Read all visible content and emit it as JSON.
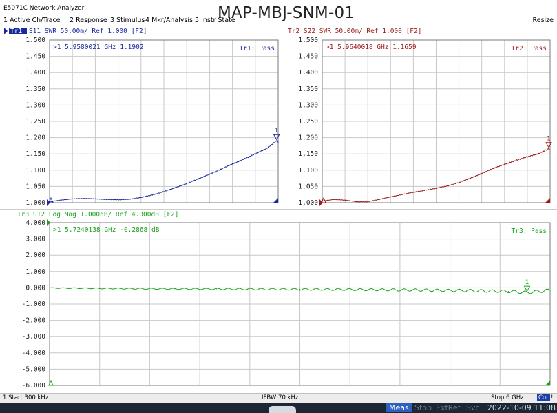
{
  "app_title": "E5071C Network Analyzer",
  "overlay_title": "MAP-MBJ-SNM-01",
  "menu": [
    "1 Active Ch/Trace",
    "2 Response",
    "3 Stimulus",
    "4 Mkr/Analysis",
    "5 Instr State"
  ],
  "resize_label": "Resize",
  "colors": {
    "tr1": "#1a2a9c",
    "tr2": "#9c1a1a",
    "tr3": "#1aa31a",
    "grid": "#c8c8c8",
    "frame": "#7a7a7a"
  },
  "chart_data": [
    {
      "type": "line",
      "trace_tag": "Tr1",
      "header": "Tr1 S11 SWR 50.00m/ Ref 1.000 [F2]",
      "pass_label": "Tr1: Pass",
      "marker_readout": ">1  5.9580021 GHz  1.1902",
      "y_ticks": [
        "1.500",
        "1.450",
        "1.400",
        "1.350",
        "1.300",
        "1.250",
        "1.200",
        "1.150",
        "1.100",
        "1.050",
        "1.000"
      ],
      "ylim": [
        1.0,
        1.5
      ],
      "xlim_ghz": [
        0.0003,
        6.0
      ],
      "marker_flag": "1",
      "x_ghz": [
        0.0003,
        0.3,
        0.6,
        0.9,
        1.2,
        1.5,
        1.8,
        2.1,
        2.4,
        2.7,
        3.0,
        3.3,
        3.6,
        3.9,
        4.2,
        4.5,
        4.8,
        5.1,
        5.4,
        5.7,
        5.958,
        6.0
      ],
      "values": [
        1.003,
        1.008,
        1.012,
        1.013,
        1.012,
        1.01,
        1.009,
        1.011,
        1.016,
        1.024,
        1.034,
        1.046,
        1.059,
        1.073,
        1.088,
        1.103,
        1.119,
        1.134,
        1.15,
        1.167,
        1.1902,
        1.186
      ]
    },
    {
      "type": "line",
      "trace_tag": "Tr2",
      "header": "Tr2 S22 SWR 50.00m/ Ref 1.000 [F2]",
      "pass_label": "Tr2: Pass",
      "marker_readout": ">1  5.9640018 GHz  1.1659",
      "y_ticks": [
        "1.500",
        "1.450",
        "1.400",
        "1.350",
        "1.300",
        "1.250",
        "1.200",
        "1.150",
        "1.100",
        "1.050",
        "1.000"
      ],
      "ylim": [
        1.0,
        1.5
      ],
      "xlim_ghz": [
        0.0003,
        6.0
      ],
      "marker_flag": "1",
      "x_ghz": [
        0.0003,
        0.3,
        0.6,
        0.9,
        1.2,
        1.5,
        1.8,
        2.1,
        2.4,
        2.7,
        3.0,
        3.3,
        3.6,
        3.9,
        4.2,
        4.5,
        4.8,
        5.1,
        5.4,
        5.7,
        5.964,
        6.0
      ],
      "values": [
        1.005,
        1.01,
        1.008,
        1.003,
        1.003,
        1.01,
        1.018,
        1.025,
        1.032,
        1.038,
        1.044,
        1.052,
        1.062,
        1.075,
        1.09,
        1.105,
        1.118,
        1.13,
        1.141,
        1.151,
        1.1659,
        1.162
      ]
    },
    {
      "type": "line",
      "trace_tag": "Tr3",
      "header": "Tr3 S12 Log Mag 1.000dB/ Ref 4.000dB [F2]",
      "pass_label": "Tr3: Pass",
      "marker_readout": ">1  5.7240138 GHz -0.2868 dB",
      "y_ticks": [
        "4.000",
        "3.000",
        "2.000",
        "1.000",
        "0.000",
        "-1.000",
        "-2.000",
        "-3.000",
        "-4.000",
        "-5.000",
        "-6.000"
      ],
      "ylim": [
        -6.0,
        4.0
      ],
      "xlim_ghz": [
        0.0003,
        6.0
      ],
      "marker_flag": "1",
      "x_ghz": [
        0.0003,
        0.5,
        1.0,
        1.5,
        2.0,
        2.5,
        3.0,
        3.5,
        4.0,
        4.5,
        5.0,
        5.5,
        5.724,
        6.0
      ],
      "values": [
        -0.01,
        -0.03,
        -0.05,
        -0.06,
        -0.07,
        -0.08,
        -0.09,
        -0.1,
        -0.12,
        -0.14,
        -0.17,
        -0.22,
        -0.2868,
        -0.15
      ]
    }
  ],
  "status": {
    "channel_start": "1  Start 300 kHz",
    "ifbw": "IFBW 70 kHz",
    "stop": "Stop 6 GHz",
    "cor": "Cor",
    "extra": "!"
  },
  "softkeys": [
    "Meas",
    "Stop",
    "ExtRef",
    "Svc"
  ],
  "datetime": "2022-10-09 11:08"
}
